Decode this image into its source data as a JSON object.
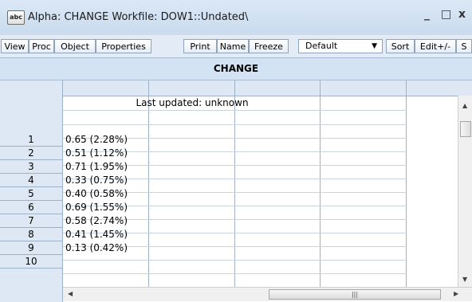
{
  "window": {
    "icon_label": "abc",
    "title": "Alpha: CHANGE   Workfile: DOW1::Undated\\",
    "minimize": "_",
    "maximize": "□",
    "close": "x"
  },
  "toolbar": {
    "view": "View",
    "proc": "Proc",
    "object": "Object",
    "properties": "Properties",
    "print": "Print",
    "name": "Name",
    "freeze": "Freeze",
    "format_value": "Default",
    "sort": "Sort",
    "edit": "Edit+/-",
    "smpl": "S"
  },
  "sheet": {
    "title": "CHANGE",
    "last_updated": "Last updated: unknown",
    "rows": [
      {
        "n": "1",
        "value": "0.65 (2.28%)"
      },
      {
        "n": "2",
        "value": "0.51 (1.12%)"
      },
      {
        "n": "3",
        "value": "0.71 (1.95%)"
      },
      {
        "n": "4",
        "value": "0.33 (0.75%)"
      },
      {
        "n": "5",
        "value": "0.40 (0.58%)"
      },
      {
        "n": "6",
        "value": "0.69 (1.55%)"
      },
      {
        "n": "7",
        "value": "0.58 (2.74%)"
      },
      {
        "n": "8",
        "value": "0.41 (1.45%)"
      },
      {
        "n": "9",
        "value": "0.13 (0.42%)"
      },
      {
        "n": "10",
        "value": ""
      }
    ]
  },
  "icons": {
    "scroll_up": "up-arrow-icon",
    "scroll_down": "down-arrow-icon",
    "scroll_left": "left-arrow-icon",
    "scroll_right": "right-arrow-icon",
    "dropdown": "chevron-down-icon"
  }
}
